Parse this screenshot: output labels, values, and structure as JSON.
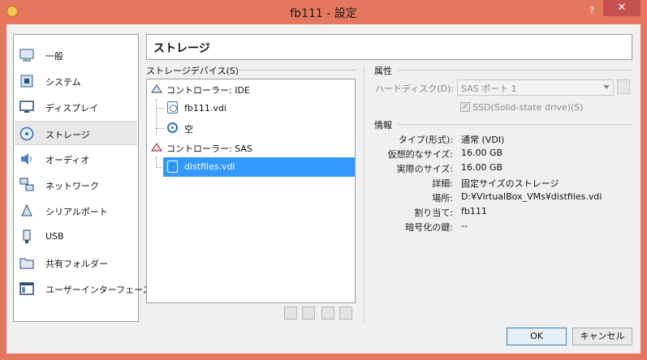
{
  "window": {
    "title": "fb111 - 設定",
    "help": "?",
    "close": "✕"
  },
  "sidebar": {
    "items": [
      {
        "label": "一般",
        "icon": "general-icon"
      },
      {
        "label": "システム",
        "icon": "system-icon"
      },
      {
        "label": "ディスプレイ",
        "icon": "display-icon"
      },
      {
        "label": "ストレージ",
        "icon": "storage-icon",
        "selected": true
      },
      {
        "label": "オーディオ",
        "icon": "audio-icon"
      },
      {
        "label": "ネットワーク",
        "icon": "network-icon"
      },
      {
        "label": "シリアルポート",
        "icon": "serial-port-icon"
      },
      {
        "label": "USB",
        "icon": "usb-icon"
      },
      {
        "label": "共有フォルダー",
        "icon": "shared-folder-icon"
      },
      {
        "label": "ユーザーインターフェース",
        "icon": "user-interface-icon"
      }
    ]
  },
  "section": {
    "title": "ストレージ"
  },
  "storage": {
    "label": "ストレージデバイス(S)",
    "tree": {
      "controller_ide": "コントローラー: IDE",
      "ide_disk": "fb111.vdi",
      "ide_cd": "空",
      "controller_sas": "コントローラー: SAS",
      "sas_disk": "distfiles.vdi"
    }
  },
  "attributes": {
    "header": "属性",
    "hard_disk_label": "ハードディスク(D):",
    "hard_disk_value": "SAS ポート 1",
    "ssd_label": "SSD(Solid-state drive)(S)",
    "ssd_checked": true
  },
  "info": {
    "header": "情報",
    "rows": [
      {
        "label": "タイプ(形式):",
        "value": "通常 (VDI)"
      },
      {
        "label": "仮想的なサイズ:",
        "value": "16.00 GB"
      },
      {
        "label": "実際のサイズ:",
        "value": "16.00 GB"
      },
      {
        "label": "詳細:",
        "value": "固定サイズのストレージ"
      },
      {
        "label": "場所:",
        "value": "D:¥VirtualBox_VMs¥distfiles.vdi"
      },
      {
        "label": "割り当て:",
        "value": "fb111"
      },
      {
        "label": "暗号化の鍵:",
        "value": "--"
      }
    ]
  },
  "buttons": {
    "ok": "OK",
    "cancel": "キャンセル"
  },
  "colors": {
    "titlebar": "#e6775f",
    "close": "#c75050",
    "selection": "#3399ff"
  }
}
